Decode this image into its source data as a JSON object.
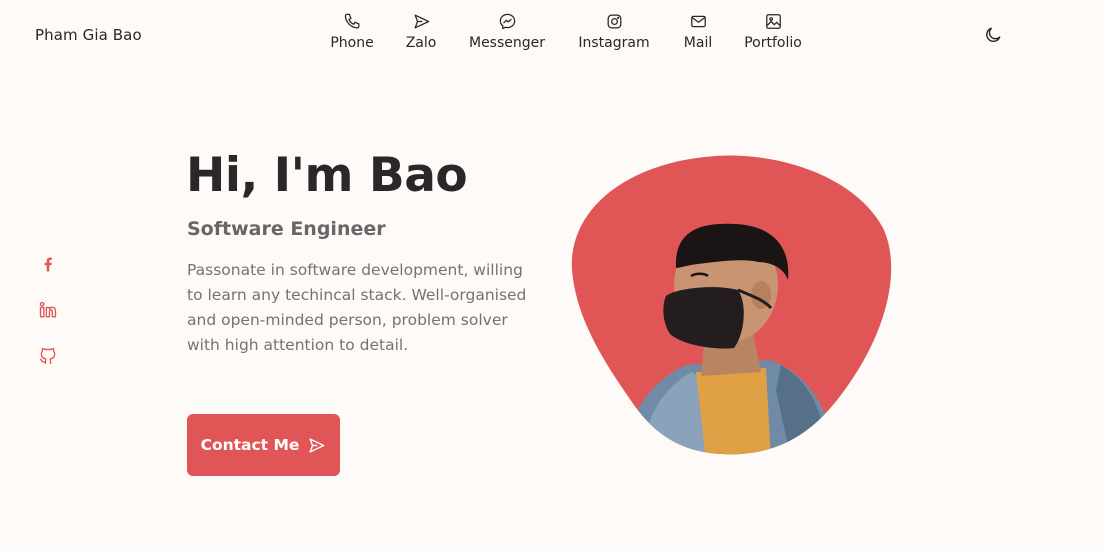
{
  "header": {
    "brand": "Pham Gia Bao",
    "nav": [
      {
        "label": "Phone",
        "icon": "phone-icon"
      },
      {
        "label": "Zalo",
        "icon": "send-icon"
      },
      {
        "label": "Messenger",
        "icon": "messenger-icon"
      },
      {
        "label": "Instagram",
        "icon": "instagram-icon"
      },
      {
        "label": "Mail",
        "icon": "mail-icon"
      },
      {
        "label": "Portfolio",
        "icon": "image-icon"
      }
    ],
    "theme_icon": "moon-icon"
  },
  "social": [
    {
      "icon": "facebook-icon"
    },
    {
      "icon": "linkedin-icon"
    },
    {
      "icon": "github-icon"
    }
  ],
  "hero": {
    "title": "Hi, I'm Bao",
    "subtitle": "Software Engineer",
    "description": "Passonate in software development, willing to learn any techincal stack. Well-organised and open-minded person, problem solver with high attention to detail.",
    "button_label": "Contact Me",
    "button_icon": "send-icon",
    "image": "profile-photo"
  },
  "colors": {
    "accent": "#e05656",
    "background": "#fdfaf8",
    "text": "#2b2729",
    "muted": "#7a7074"
  }
}
